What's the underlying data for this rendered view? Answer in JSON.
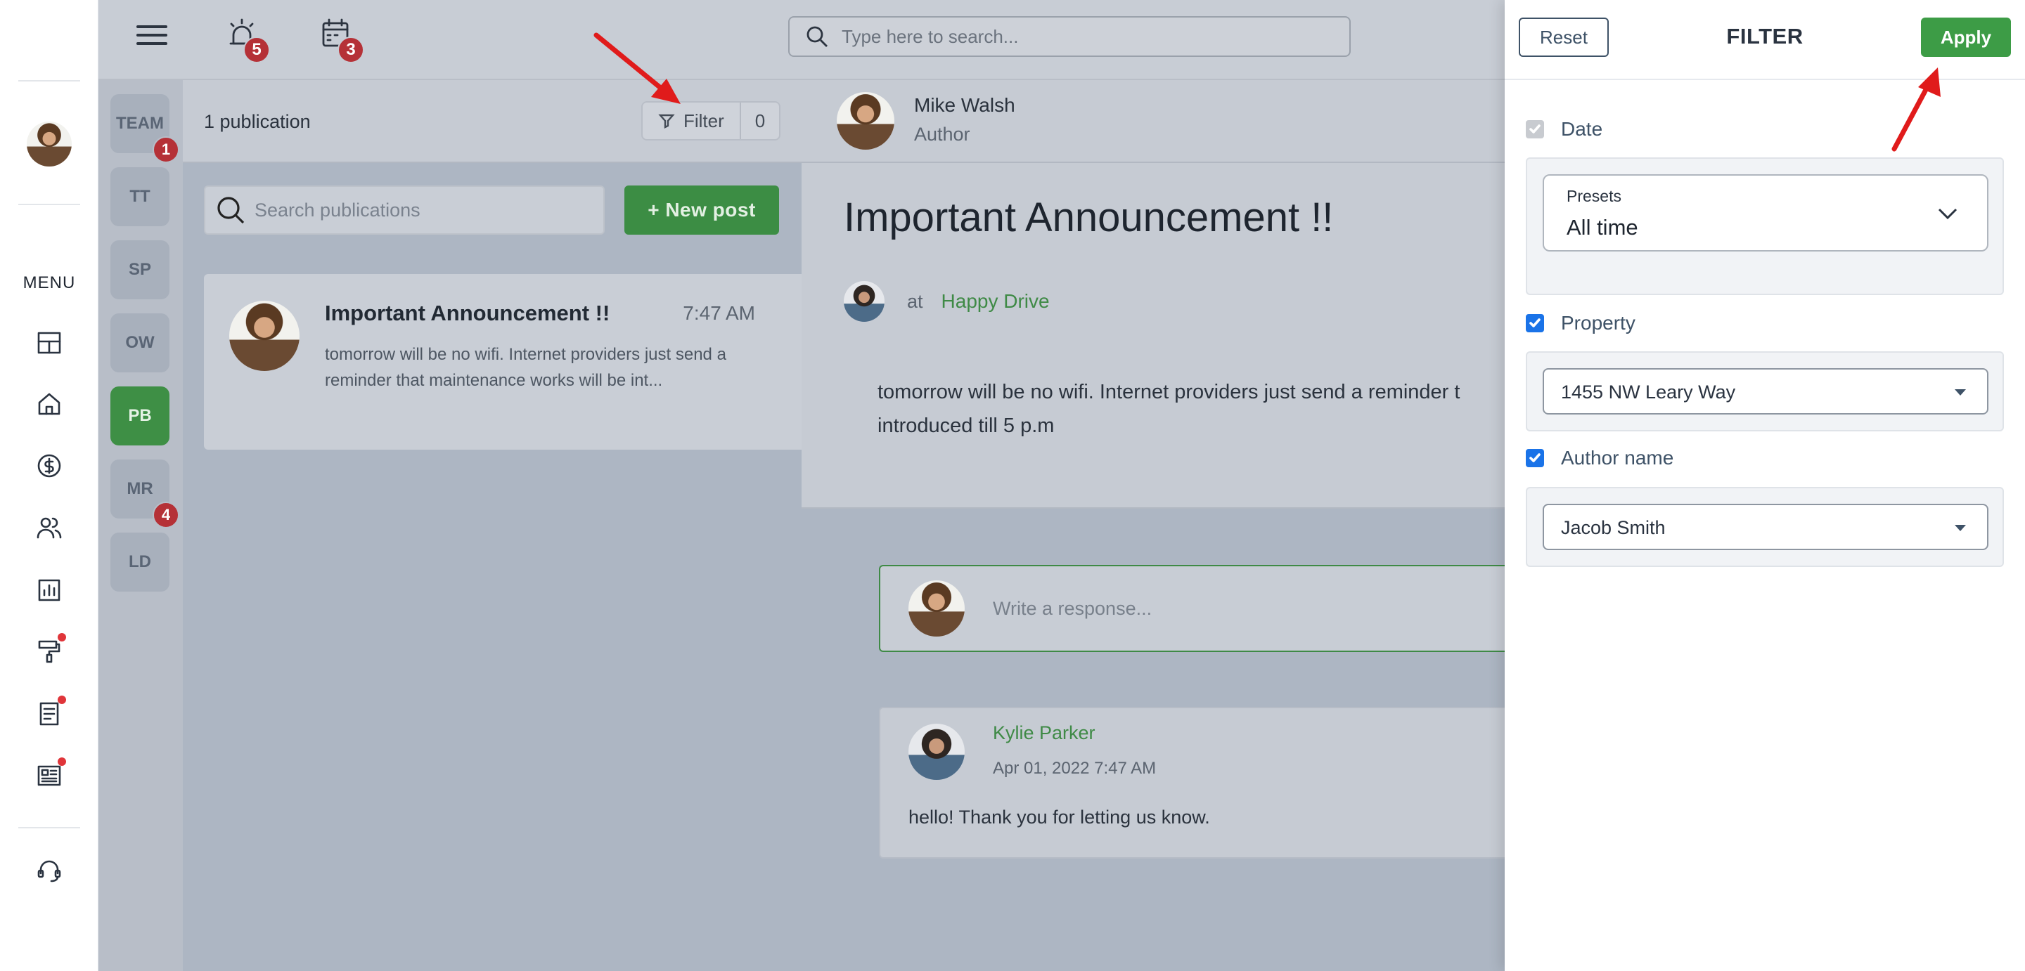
{
  "topbar": {
    "search_placeholder": "Type here to search...",
    "alarm_badge": "5",
    "calendar_badge": "3"
  },
  "rail": {
    "menu_label": "MENU",
    "items": [
      {
        "icon": "dashboard-icon",
        "dot": false
      },
      {
        "icon": "home-icon",
        "dot": false
      },
      {
        "icon": "dollar-icon",
        "dot": false
      },
      {
        "icon": "users-icon",
        "dot": false
      },
      {
        "icon": "chart-icon",
        "dot": false
      },
      {
        "icon": "paint-roller-icon",
        "dot": true
      },
      {
        "icon": "document-icon",
        "dot": true
      },
      {
        "icon": "newspaper-icon",
        "dot": true
      }
    ],
    "support_icon": "headset-icon"
  },
  "teams": [
    {
      "label": "TEAM",
      "badge": "1",
      "active": false
    },
    {
      "label": "TT",
      "badge": "",
      "active": false
    },
    {
      "label": "SP",
      "badge": "",
      "active": false
    },
    {
      "label": "OW",
      "badge": "",
      "active": false
    },
    {
      "label": "PB",
      "badge": "",
      "active": true
    },
    {
      "label": "MR",
      "badge": "4",
      "active": false
    },
    {
      "label": "LD",
      "badge": "",
      "active": false
    }
  ],
  "publications": {
    "count_label": "1 publication",
    "filter_label": "Filter",
    "filter_count": "0",
    "search_placeholder": "Search publications",
    "new_post_label": "+ New post",
    "items": [
      {
        "title": "Important Announcement !!",
        "time": "7:47 AM",
        "excerpt": "tomorrow will be no wifi. Internet providers just send a reminder that maintenance works will be int..."
      }
    ]
  },
  "post": {
    "author_name": "Mike Walsh",
    "author_role": "Author",
    "title": "Important Announcement !!",
    "at_label": "at",
    "property": "Happy Drive",
    "body_line1": "tomorrow will be no wifi. Internet providers just send a reminder t",
    "body_line2": "introduced till 5 p.m",
    "reply_placeholder": "Write a response...",
    "comment": {
      "name": "Kylie Parker",
      "date": "Apr 01, 2022 7:47 AM",
      "text": "hello! Thank you for letting us know."
    }
  },
  "filter": {
    "reset_label": "Reset",
    "title": "FILTER",
    "apply_label": "Apply",
    "date_label": "Date",
    "date_checked": false,
    "presets_label": "Presets",
    "presets_value": "All time",
    "property_label": "Property",
    "property_checked": true,
    "property_value": "1455 NW Leary Way",
    "author_label": "Author name",
    "author_checked": true,
    "author_value": "Jacob Smith"
  },
  "colors": {
    "accent_green": "#3d9c46",
    "badge_red": "#b53137",
    "checkbox_blue": "#1a73e8",
    "annotation_arrow": "#e01b1b"
  }
}
